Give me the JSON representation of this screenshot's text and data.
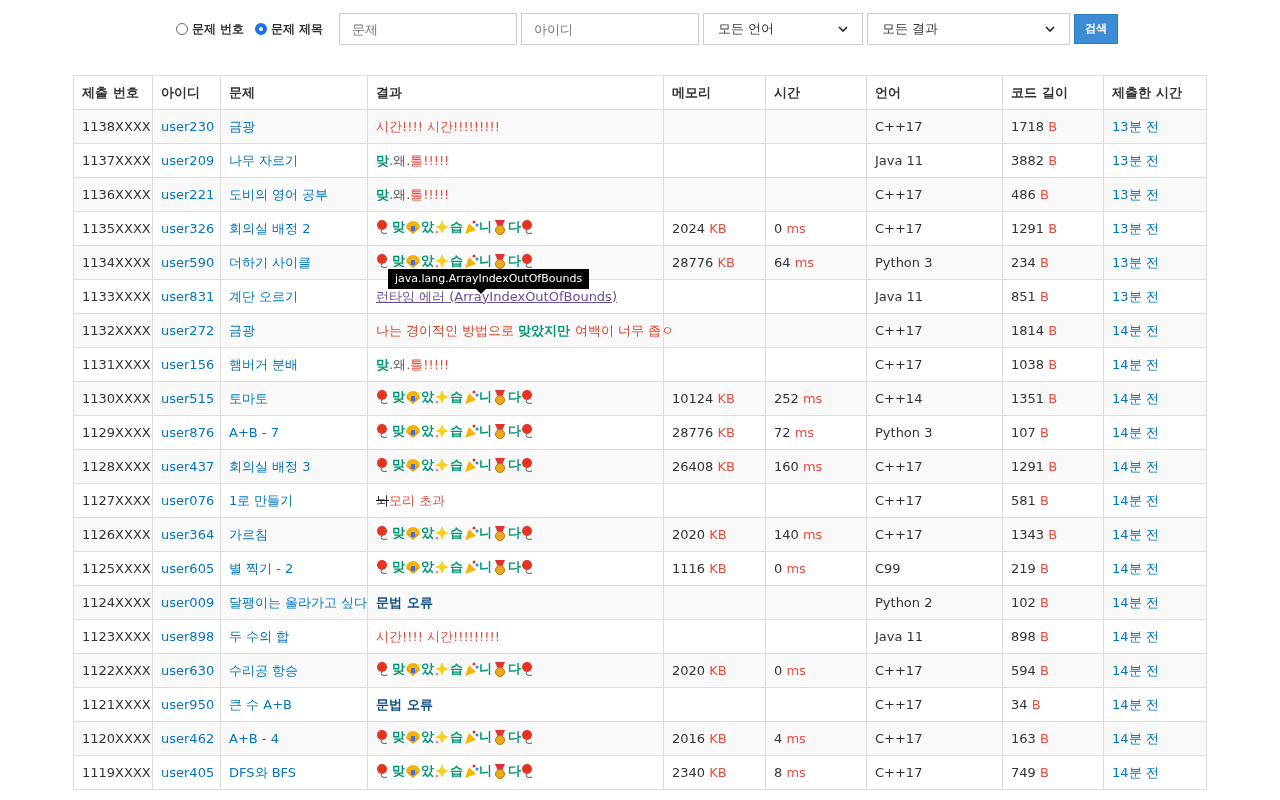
{
  "search": {
    "modes": [
      {
        "label": "문제 번호",
        "selected": false
      },
      {
        "label": "문제 제목",
        "selected": true
      }
    ],
    "problem_field": {
      "placeholder": "문제"
    },
    "user_field": {
      "placeholder": "아이디"
    },
    "language_select": {
      "value": "모든 언어"
    },
    "result_select": {
      "value": "모든 결과"
    },
    "button": "검색"
  },
  "table": {
    "columns": [
      "제출 번호",
      "아이디",
      "문제",
      "결과",
      "메모리",
      "시간",
      "언어",
      "코드 길이",
      "제출한 시간"
    ],
    "rows": [
      {
        "id": "1138XXXX",
        "user": "user230",
        "problem": "금광",
        "result": {
          "kind": "parts",
          "parts": [
            {
              "text": "시간!!!! 시간!!!!!!!!!",
              "color": "#e74c3c",
              "bold": false,
              "struck": false
            }
          ]
        },
        "language": "C++17",
        "length": {
          "value": "1718",
          "unit": "B"
        },
        "submitted": "13분 전"
      },
      {
        "id": "1137XXXX",
        "user": "user209",
        "problem": "나무 자르기",
        "result": {
          "kind": "parts",
          "parts": [
            {
              "text": "맞",
              "color": "#009874",
              "bold": true,
              "struck": false
            },
            {
              "text": ".왜.",
              "color": "#555555",
              "bold": false,
              "struck": false
            },
            {
              "text": "틀!!!!!",
              "color": "#e74c3c",
              "bold": false,
              "struck": false
            }
          ]
        },
        "language": "Java 11",
        "length": {
          "value": "3882",
          "unit": "B"
        },
        "submitted": "13분 전"
      },
      {
        "id": "1136XXXX",
        "user": "user221",
        "problem": "도비의 영어 공부",
        "result": {
          "kind": "parts",
          "parts": [
            {
              "text": "맞",
              "color": "#009874",
              "bold": true,
              "struck": false
            },
            {
              "text": ".왜.",
              "color": "#555555",
              "bold": false,
              "struck": false
            },
            {
              "text": "틀!!!!!",
              "color": "#e74c3c",
              "bold": false,
              "struck": false
            }
          ]
        },
        "language": "C++17",
        "length": {
          "value": "486",
          "unit": "B"
        },
        "submitted": "13분 전"
      },
      {
        "id": "1135XXXX",
        "user": "user326",
        "problem": "회의실 배정 2",
        "result": {
          "kind": "celebration",
          "syllables": [
            "맞",
            "았",
            "습",
            "니",
            "다"
          ]
        },
        "memory": {
          "value": "2024",
          "unit": "KB"
        },
        "time": {
          "value": "0",
          "unit": "ms"
        },
        "language": "C++17",
        "length": {
          "value": "1291",
          "unit": "B"
        },
        "submitted": "13분 전"
      },
      {
        "id": "1134XXXX",
        "user": "user590",
        "problem": "더하기 사이클",
        "result": {
          "kind": "celebration",
          "syllables": [
            "맞",
            "았",
            "습",
            "니",
            "다"
          ]
        },
        "memory": {
          "value": "28776",
          "unit": "KB"
        },
        "time": {
          "value": "64",
          "unit": "ms"
        },
        "language": "Python 3",
        "length": {
          "value": "234",
          "unit": "B"
        },
        "submitted": "13분 전"
      },
      {
        "id": "1133XXXX",
        "user": "user831",
        "problem": "계단 오르기",
        "result": {
          "kind": "link",
          "text": "런타임 에러 (ArrayIndexOutOfBounds)",
          "tooltip": "java.lang.ArrayIndexOutOfBounds"
        },
        "language": "Java 11",
        "length": {
          "value": "851",
          "unit": "B"
        },
        "submitted": "13분 전"
      },
      {
        "id": "1132XXXX",
        "user": "user272",
        "problem": "금광",
        "result": {
          "kind": "parts",
          "parts": [
            {
              "text": "나는 경이적인 방법으로 ",
              "color": "#dd4124",
              "bold": false,
              "struck": false
            },
            {
              "text": "맞았지만",
              "color": "#009874",
              "bold": true,
              "struck": false
            },
            {
              "text": " 여백이 너무 좁ㅇ",
              "color": "#dd4124",
              "bold": false,
              "struck": false
            }
          ]
        },
        "language": "C++17",
        "length": {
          "value": "1814",
          "unit": "B"
        },
        "submitted": "14분 전"
      },
      {
        "id": "1131XXXX",
        "user": "user156",
        "problem": "햄버거 분배",
        "result": {
          "kind": "parts",
          "parts": [
            {
              "text": "맞",
              "color": "#009874",
              "bold": true,
              "struck": false
            },
            {
              "text": ".왜.",
              "color": "#555555",
              "bold": false,
              "struck": false
            },
            {
              "text": "틀!!!!!",
              "color": "#e74c3c",
              "bold": false,
              "struck": false
            }
          ]
        },
        "language": "C++17",
        "length": {
          "value": "1038",
          "unit": "B"
        },
        "submitted": "14분 전"
      },
      {
        "id": "1130XXXX",
        "user": "user515",
        "problem": "토마토",
        "result": {
          "kind": "celebration",
          "syllables": [
            "맞",
            "았",
            "습",
            "니",
            "다"
          ]
        },
        "memory": {
          "value": "10124",
          "unit": "KB"
        },
        "time": {
          "value": "252",
          "unit": "ms"
        },
        "language": "C++14",
        "length": {
          "value": "1351",
          "unit": "B"
        },
        "submitted": "14분 전"
      },
      {
        "id": "1129XXXX",
        "user": "user876",
        "problem": "A+B - 7",
        "result": {
          "kind": "celebration",
          "syllables": [
            "맞",
            "았",
            "습",
            "니",
            "다"
          ]
        },
        "memory": {
          "value": "28776",
          "unit": "KB"
        },
        "time": {
          "value": "72",
          "unit": "ms"
        },
        "language": "Python 3",
        "length": {
          "value": "107",
          "unit": "B"
        },
        "submitted": "14분 전"
      },
      {
        "id": "1128XXXX",
        "user": "user437",
        "problem": "회의실 배정 3",
        "result": {
          "kind": "celebration",
          "syllables": [
            "맞",
            "았",
            "습",
            "니",
            "다"
          ]
        },
        "memory": {
          "value": "26408",
          "unit": "KB"
        },
        "time": {
          "value": "160",
          "unit": "ms"
        },
        "language": "C++17",
        "length": {
          "value": "1291",
          "unit": "B"
        },
        "submitted": "14분 전"
      },
      {
        "id": "1127XXXX",
        "user": "user076",
        "problem": "1로 만들기",
        "result": {
          "kind": "parts",
          "parts": [
            {
              "text": "뇌",
              "color": "#111111",
              "bold": false,
              "struck": true
            },
            {
              "text": "모리 초과",
              "color": "#e74c3c",
              "bold": false,
              "struck": false
            }
          ]
        },
        "language": "C++17",
        "length": {
          "value": "581",
          "unit": "B"
        },
        "submitted": "14분 전"
      },
      {
        "id": "1126XXXX",
        "user": "user364",
        "problem": "가르침",
        "result": {
          "kind": "celebration",
          "syllables": [
            "맞",
            "았",
            "습",
            "니",
            "다"
          ]
        },
        "memory": {
          "value": "2020",
          "unit": "KB"
        },
        "time": {
          "value": "140",
          "unit": "ms"
        },
        "language": "C++17",
        "length": {
          "value": "1343",
          "unit": "B"
        },
        "submitted": "14분 전"
      },
      {
        "id": "1125XXXX",
        "user": "user605",
        "problem": "별 찍기 - 2",
        "result": {
          "kind": "celebration",
          "syllables": [
            "맞",
            "았",
            "습",
            "니",
            "다"
          ]
        },
        "memory": {
          "value": "1116",
          "unit": "KB"
        },
        "time": {
          "value": "0",
          "unit": "ms"
        },
        "language": "C99",
        "length": {
          "value": "219",
          "unit": "B"
        },
        "submitted": "14분 전"
      },
      {
        "id": "1124XXXX",
        "user": "user009",
        "problem": "달팽이는 올라가고 싶다",
        "result": {
          "kind": "parts",
          "parts": [
            {
              "text": "문법 오류",
              "color": "#0f4c81",
              "bold": true,
              "struck": false
            }
          ]
        },
        "language": "Python 2",
        "length": {
          "value": "102",
          "unit": "B"
        },
        "submitted": "14분 전"
      },
      {
        "id": "1123XXXX",
        "user": "user898",
        "problem": "두 수의 합",
        "result": {
          "kind": "parts",
          "parts": [
            {
              "text": "시간!!!! 시간!!!!!!!!!",
              "color": "#e74c3c",
              "bold": false,
              "struck": false
            }
          ]
        },
        "language": "Java 11",
        "length": {
          "value": "898",
          "unit": "B"
        },
        "submitted": "14분 전"
      },
      {
        "id": "1122XXXX",
        "user": "user630",
        "problem": "수리공 항승",
        "result": {
          "kind": "celebration",
          "syllables": [
            "맞",
            "았",
            "습",
            "니",
            "다"
          ]
        },
        "memory": {
          "value": "2020",
          "unit": "KB"
        },
        "time": {
          "value": "0",
          "unit": "ms"
        },
        "language": "C++17",
        "length": {
          "value": "594",
          "unit": "B"
        },
        "submitted": "14분 전"
      },
      {
        "id": "1121XXXX",
        "user": "user950",
        "problem": "큰 수 A+B",
        "result": {
          "kind": "parts",
          "parts": [
            {
              "text": "문법 오류",
              "color": "#0f4c81",
              "bold": true,
              "struck": false
            }
          ]
        },
        "language": "C++17",
        "length": {
          "value": "34",
          "unit": "B"
        },
        "submitted": "14분 전"
      },
      {
        "id": "1120XXXX",
        "user": "user462",
        "problem": "A+B - 4",
        "result": {
          "kind": "celebration",
          "syllables": [
            "맞",
            "았",
            "습",
            "니",
            "다"
          ]
        },
        "memory": {
          "value": "2016",
          "unit": "KB"
        },
        "time": {
          "value": "4",
          "unit": "ms"
        },
        "language": "C++17",
        "length": {
          "value": "163",
          "unit": "B"
        },
        "submitted": "14분 전"
      },
      {
        "id": "1119XXXX",
        "user": "user405",
        "problem": "DFS와 BFS",
        "result": {
          "kind": "celebration",
          "syllables": [
            "맞",
            "았",
            "습",
            "니",
            "다"
          ]
        },
        "memory": {
          "value": "2340",
          "unit": "KB"
        },
        "time": {
          "value": "8",
          "unit": "ms"
        },
        "language": "C++17",
        "length": {
          "value": "749",
          "unit": "B"
        },
        "submitted": "14분 전"
      }
    ]
  }
}
